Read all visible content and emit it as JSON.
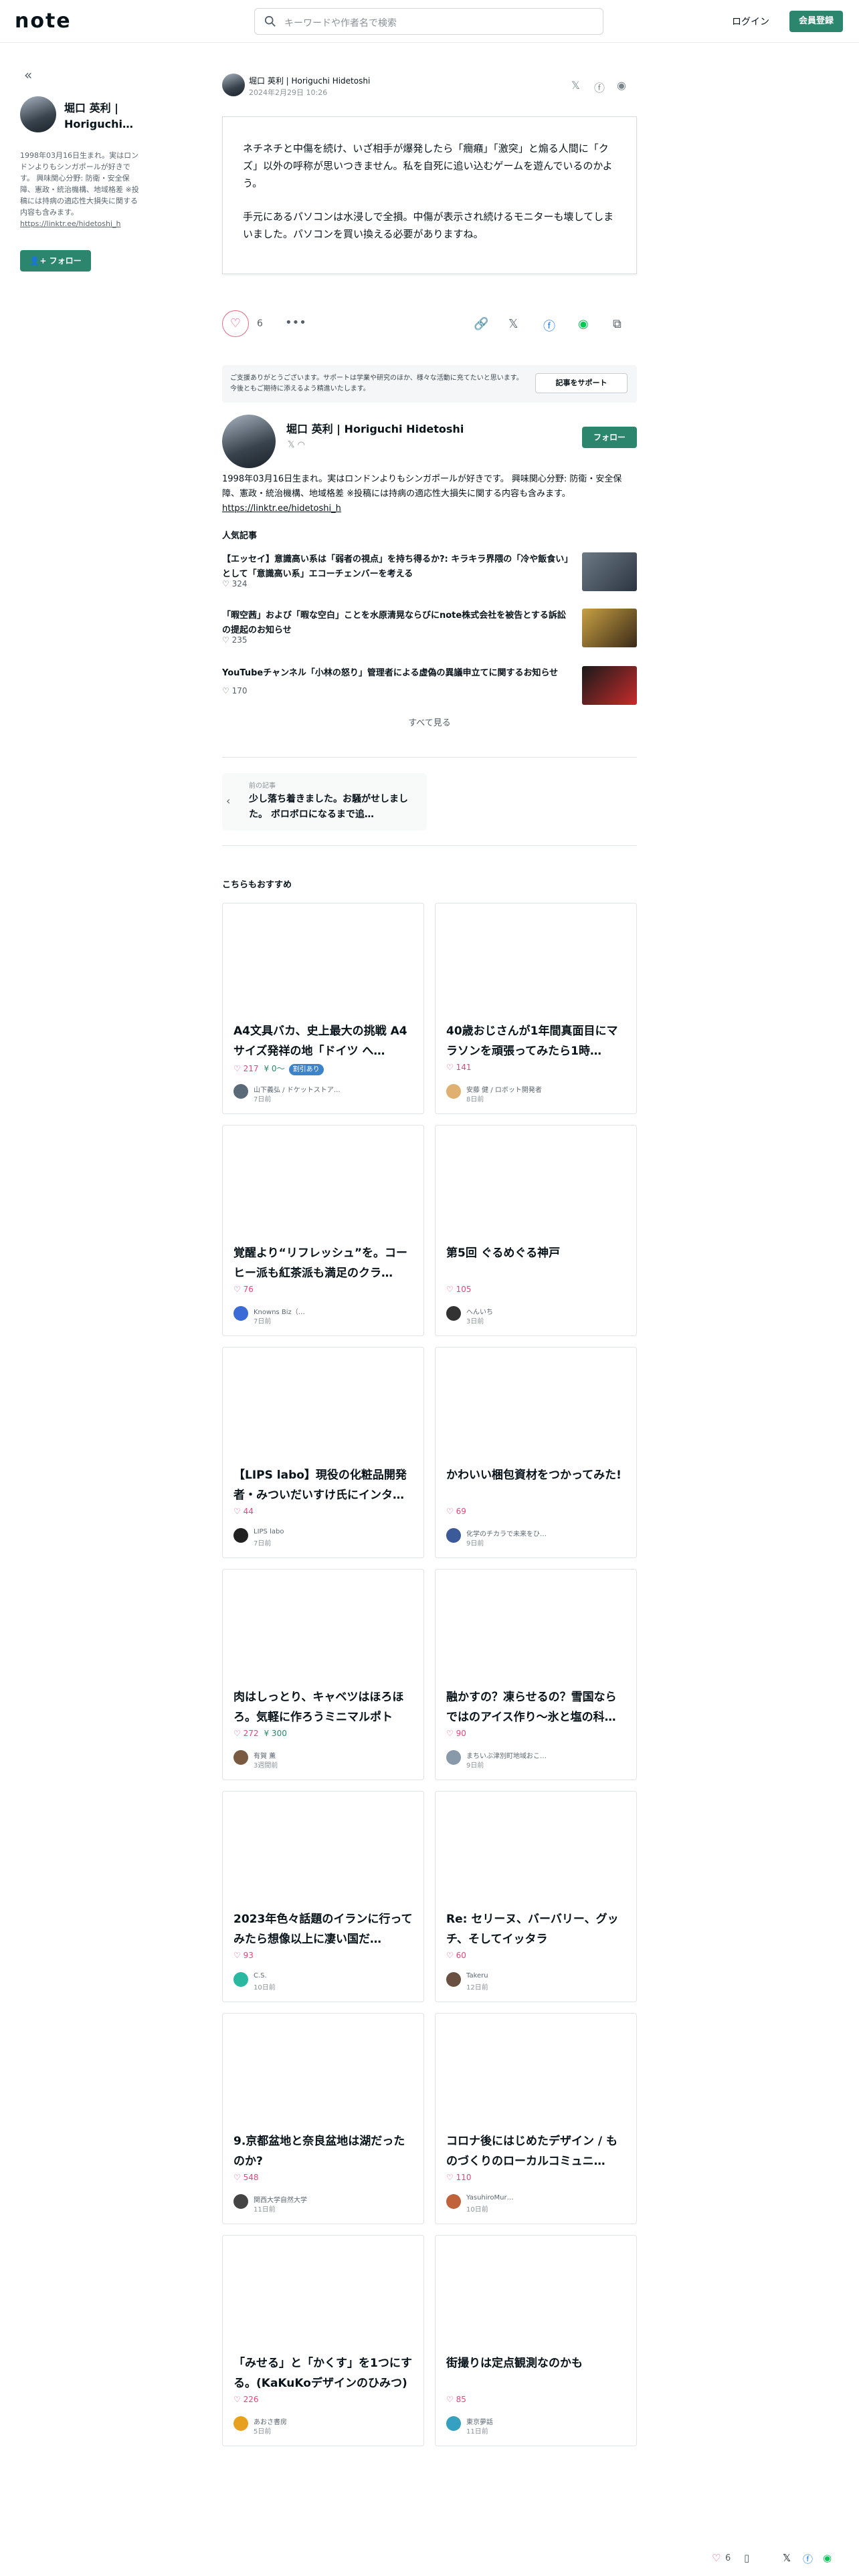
{
  "header": {
    "logo": "note",
    "search_placeholder": "キーワードや作者名で検索",
    "login": "ログイン",
    "signup": "会員登録"
  },
  "sidebar": {
    "collapse": "«",
    "author_name": "堀口 英利 | Horiguchi…",
    "bio": "1998年03月16日生まれ。実はロンドンよりもシンガポールが好きです。 興味関心分野: 防衛・安全保障、憲政・統治機構、地域格差 ※投稿には持病の適応性大損失に関する内容も含みます。",
    "link": "https://linktr.ee/hidetoshi_h",
    "follow": "フォロー"
  },
  "article": {
    "author": "堀口 英利 | Horiguchi Hidetoshi",
    "date": "2024年2月29日 10:26",
    "quote": [
      "ネチネチと中傷を続け、いざ相手が爆発したら「癇癪」「激突」と煽る人間に「クズ」以外の呼称が思いつきません。私を自死に追い込むゲームを遊んでいるのかよう。",
      "手元にあるパソコンは水浸しで全損。中傷が表示され続けるモニターも壊してしまいました。パソコンを買い換える必要がありますね。"
    ],
    "like_count": "6",
    "share_icons": [
      "x-icon",
      "facebook-icon",
      "line-icon"
    ]
  },
  "support": {
    "text": "ご支援ありがとうございます。サポートは学業や研究のほか、様々な活動に充てたいと思います。今後ともご期待に添えるよう精進いたします。",
    "button": "記事をサポート"
  },
  "profile": {
    "name": "堀口 英利 | Horiguchi Hidetoshi",
    "follow": "フォロー",
    "bio": "1998年03月16日生まれ。実はロンドンよりもシンガポールが好きです。 興味関心分野: 防衛・安全保障、憲政・統治機構、地域格差 ※投稿には持病の適応性大損失に関する内容も含みます。",
    "link": "https://linktr.ee/hidetoshi_h"
  },
  "popular": {
    "heading": "人気記事",
    "items": [
      {
        "title": "【エッセイ】意識高い系は「弱者の視点」を持ち得るか?: キラキラ界隈の「冷や飯食い」として「意識高い系」エコーチェンバーを考える",
        "likes": "324"
      },
      {
        "title": "「暇空茜」および「暇な空白」ことを水原清晃ならびにnote株式会社を被告とする訴訟の提起のお知らせ",
        "likes": "235"
      },
      {
        "title": "YouTubeチャンネル「小林の怒り」管理者による虚偽の異議申立てに関するお知らせ",
        "likes": "170"
      }
    ],
    "see_all": "すべて見る"
  },
  "prev_article": {
    "label": "前の記事",
    "title": "少し落ち着きました。お騒がせしました。 ボロボロになるまで追…"
  },
  "recommend": {
    "heading": "こちらもおすすめ",
    "cards": [
      {
        "title": "A4文具バカ、史上最大の挑戦 A4サイズ発祥の地「ドイツ へ…",
        "likes": "217",
        "coins": "0〜",
        "badge": "割引あり",
        "author": "山下義弘 / ドケットストア…",
        "time": "7日前"
      },
      {
        "title": "40歳おじさんが1年間真面目にマラソンを頑張ってみたら1時…",
        "likes": "141",
        "author": "安藤 健 / ロボット開発者",
        "time": "8日前"
      },
      {
        "title": "覚醒より“リフレッシュ”を。コーヒー派も紅茶派も満足のクラ…",
        "likes": "76",
        "author": "Knowns Biz（…",
        "time": "7日前"
      },
      {
        "title": "第5回 ぐるめぐる神戸",
        "likes": "105",
        "author": "へんいち",
        "time": "3日前"
      },
      {
        "title": "【LIPS labo】現役の化粧品開発者・みついだいすけ氏にインタ…",
        "likes": "44",
        "author": "LIPS labo",
        "time": "7日前"
      },
      {
        "title": "かわいい梱包資材をつかってみた!",
        "likes": "69",
        "author": "化学のチカラで未来をひ…",
        "time": "9日前"
      },
      {
        "title": "肉はしっとり、キャベツはほろほろ。気軽に作ろうミニマルポトフ。",
        "likes": "272",
        "coins": "300",
        "author": "有賀 薫",
        "time": "3週間前"
      },
      {
        "title": "融かすの？凍らせるの？雪国ならではのアイス作り〜氷と塩の科…",
        "likes": "90",
        "author": "まちいぶ津別町地域おこ…",
        "time": "9日前"
      },
      {
        "title": "2023年色々話題のイランに行ってみたら想像以上に凄い国だ…",
        "likes": "93",
        "author": "C.S.",
        "time": "10日前"
      },
      {
        "title": "Re: セリーヌ、バーバリー、グッチ、そしてイッタラ",
        "likes": "60",
        "author": "Takeru",
        "time": "12日前"
      },
      {
        "title": "9.京都盆地と奈良盆地は湖だったのか?",
        "likes": "548",
        "author": "関西大学自然大学",
        "time": "11日前"
      },
      {
        "title": "コロナ後にはじめたデザイン / ものづくりのローカルコミュニ…",
        "likes": "110",
        "author": "YasuhiroMur…",
        "time": "10日前"
      },
      {
        "title": "「みせる」と「かくす」を1つにする。(KaKuKoデザインのひみつ)",
        "likes": "226",
        "author": "あおさ書房",
        "time": "5日前"
      },
      {
        "title": "街撮りは定点観測なのかも",
        "likes": "85",
        "author": "東京夢話",
        "time": "11日前"
      }
    ]
  },
  "footer_bar": {
    "likes": "6"
  }
}
